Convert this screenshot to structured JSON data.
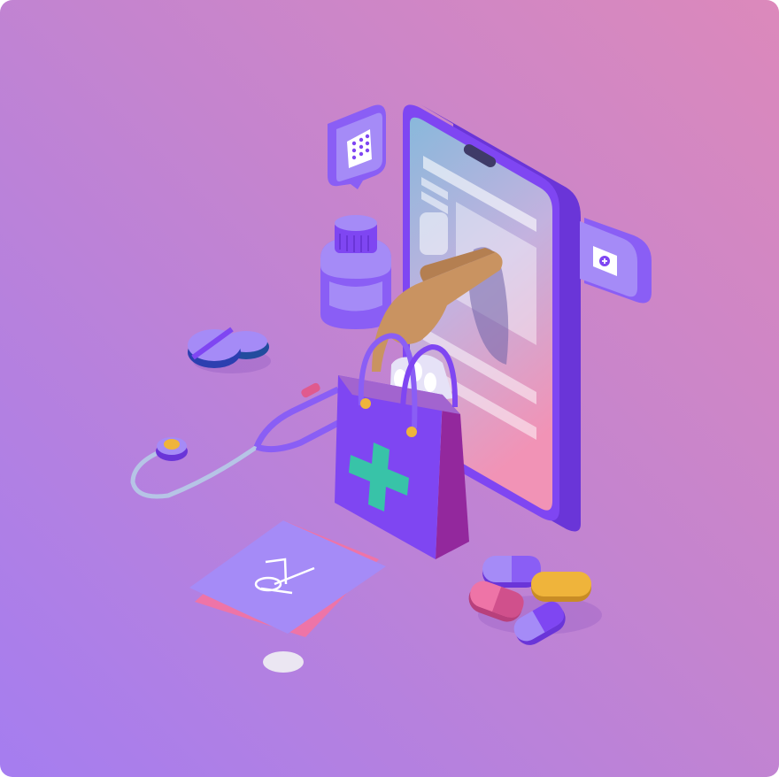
{
  "illustration": {
    "subject": "",
    "colors": {
      "background_top": "#dc89bb",
      "background_bottom": "#a57df0",
      "purple": "#7f46f2",
      "purple_dark": "#6a35d8",
      "lavender": "#a58bf7",
      "teal_cross": "#38c3a8",
      "skin": "#c99361",
      "pink": "#ee74a7",
      "yellow": "#efb43b"
    },
    "icons": [
      "smartphone-icon",
      "pill-blister-bubble-icon",
      "medicine-bottle-icon",
      "shopping-bag-icon",
      "hand-icon",
      "stethoscope-icon",
      "prescription-paper-icon",
      "capsule-icon",
      "pill-tablet-icon",
      "first-aid-tab-icon"
    ]
  }
}
